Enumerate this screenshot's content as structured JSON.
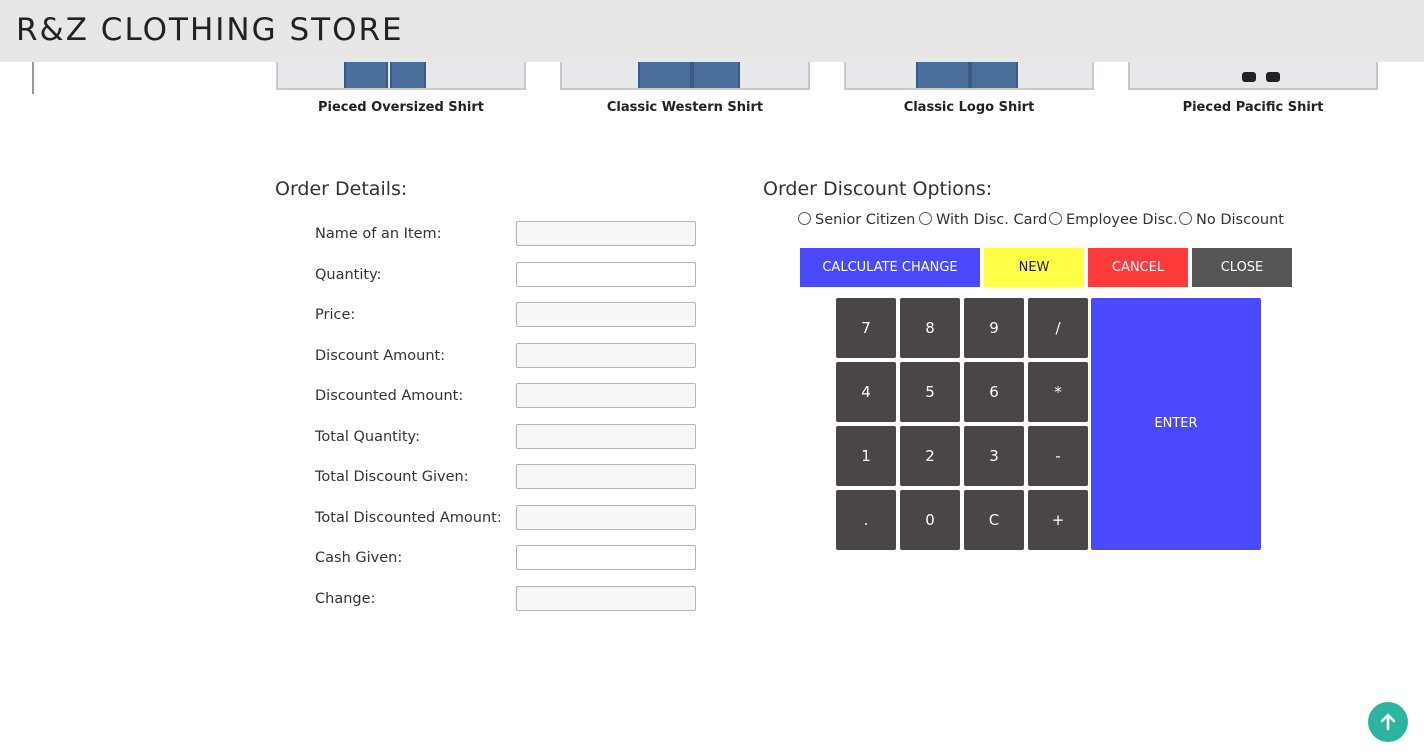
{
  "header": {
    "brand": "R&Z CLOTHING STORE"
  },
  "products": [
    {
      "name": "Pieced Oversized Shirt"
    },
    {
      "name": "Classic Western Shirt"
    },
    {
      "name": "Classic Logo Shirt"
    },
    {
      "name": "Pieced Pacific Shirt"
    }
  ],
  "order_details": {
    "title": "Order Details:",
    "fields": [
      {
        "label": "Name of an Item:",
        "value": ""
      },
      {
        "label": "Quantity:",
        "value": ""
      },
      {
        "label": "Price:",
        "value": ""
      },
      {
        "label": "Discount Amount:",
        "value": ""
      },
      {
        "label": "Discounted Amount:",
        "value": ""
      },
      {
        "label": "Total Quantity:",
        "value": ""
      },
      {
        "label": "Total Discount Given:",
        "value": ""
      },
      {
        "label": "Total Discounted Amount:",
        "value": ""
      },
      {
        "label": "Cash Given:",
        "value": ""
      },
      {
        "label": "Change:",
        "value": ""
      }
    ]
  },
  "discount": {
    "title": "Order Discount Options:",
    "options": [
      "Senior Citizen",
      "With Disc. Card",
      "Employee Disc.",
      "No Discount"
    ]
  },
  "actions": {
    "calculate": "CALCULATE CHANGE",
    "new": "NEW",
    "cancel": "CANCEL",
    "close": "CLOSE"
  },
  "keypad": {
    "keys": [
      "7",
      "8",
      "9",
      "/",
      "4",
      "5",
      "6",
      "*",
      "1",
      "2",
      "3",
      "-",
      ".",
      "0",
      "C",
      "+"
    ],
    "enter": "ENTER"
  },
  "colors": {
    "calculate": "#4a49fb",
    "new": "#ffff47",
    "cancel": "#ff3b3b",
    "close": "#555555",
    "key": "#4a4646",
    "enter": "#4a49fb",
    "to_top": "#2bb5a1",
    "header": "#e8e7e6"
  },
  "icons": {
    "to_top": "arrow-up-icon"
  }
}
